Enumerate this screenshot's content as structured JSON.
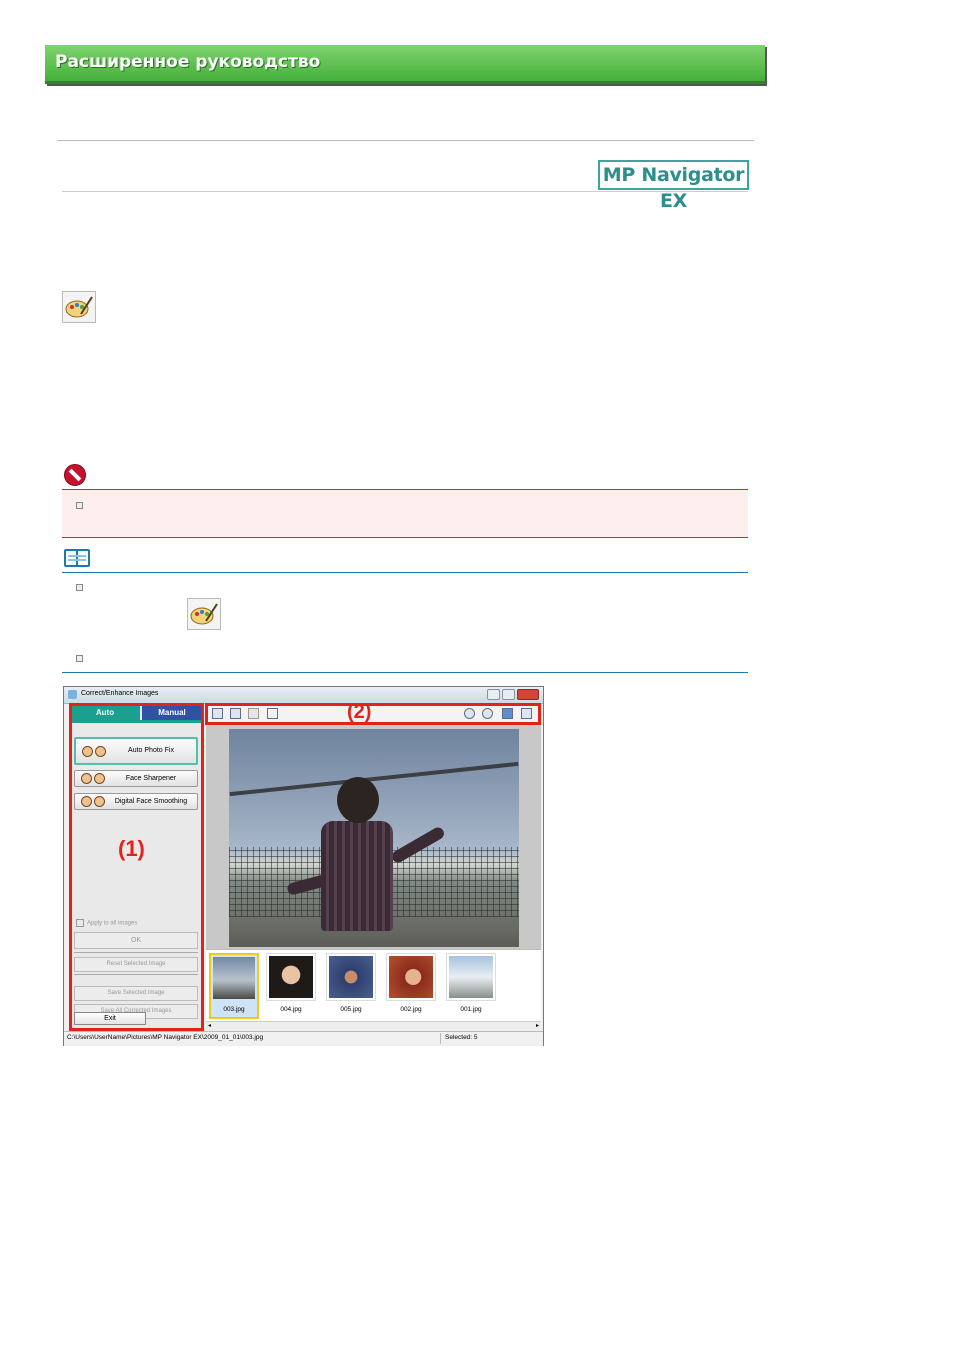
{
  "header": {
    "title": "Расширенное руководство"
  },
  "product_badge": "MP Navigator EX",
  "window": {
    "title": "Correct/Enhance Images",
    "tabs": [
      "Auto",
      "Manual"
    ],
    "buttons": {
      "auto_photo_fix": "Auto Photo Fix",
      "face_sharpener": "Face Sharpener",
      "digital_face_smoothing": "Digital Face Smoothing",
      "apply_all": "Apply to all images",
      "ok": "OK",
      "reset": "Reset Selected Image",
      "save_selected": "Save Selected Image",
      "save_all": "Save All Corrected Images",
      "exit": "Exit"
    },
    "callouts": [
      "(1)",
      "(2)"
    ],
    "thumbnails": [
      "003.jpg",
      "004.jpg",
      "005.jpg",
      "002.jpg",
      "001.jpg"
    ],
    "status": {
      "path": "C:\\Users\\UserName\\Pictures\\MP Navigator EX\\2009_01_01\\003.jpg",
      "selected": "Selected: 5"
    }
  }
}
